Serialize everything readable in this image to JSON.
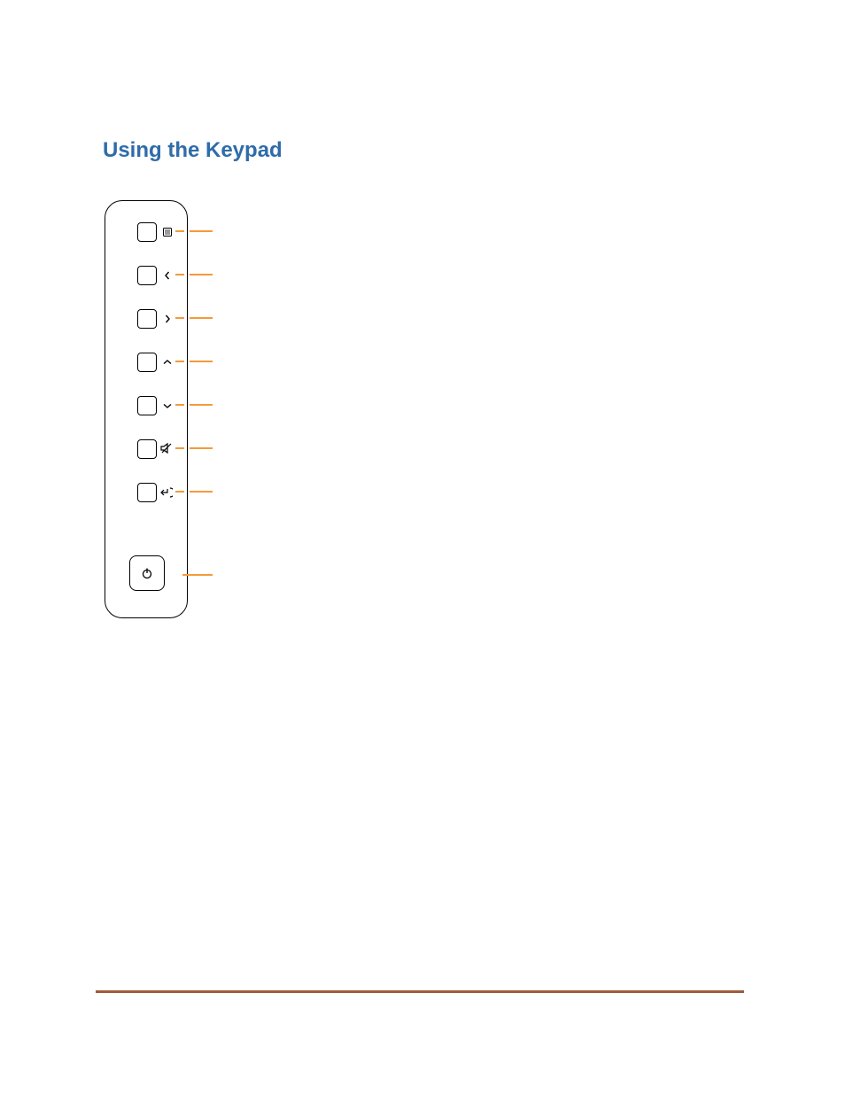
{
  "heading": "Using the Keypad",
  "keypad": {
    "buttons": [
      {
        "name": "menu",
        "icon": "menu-lines-icon"
      },
      {
        "name": "left",
        "icon": "chevron-left-icon"
      },
      {
        "name": "right",
        "icon": "chevron-right-icon"
      },
      {
        "name": "up",
        "icon": "chevron-up-icon"
      },
      {
        "name": "down",
        "icon": "chevron-down-icon"
      },
      {
        "name": "mute",
        "icon": "mute-icon"
      },
      {
        "name": "enter",
        "icon": "enter-icon"
      }
    ],
    "power": {
      "icon": "power-icon"
    }
  }
}
